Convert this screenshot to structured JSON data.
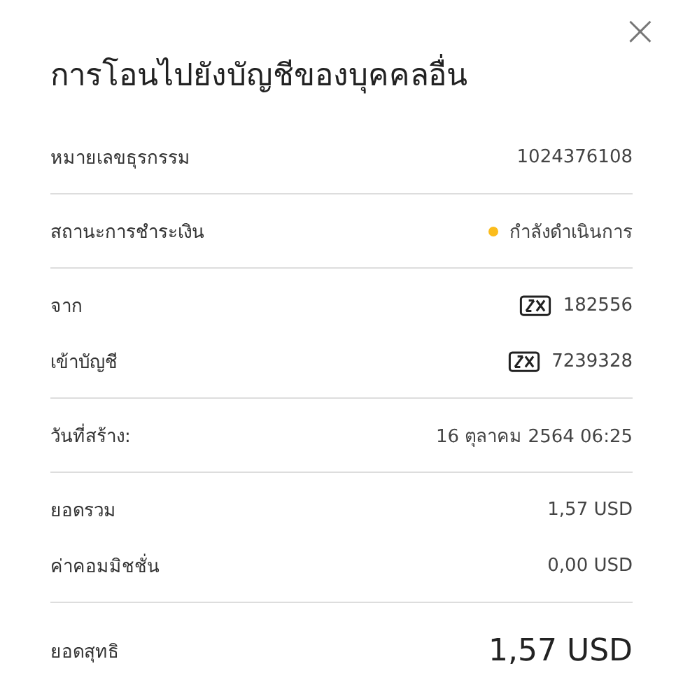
{
  "close": "×",
  "title": "การโอนไปยังบัญชีของบุคคลอื่น",
  "sections": [
    {
      "rows": [
        {
          "kind": "text",
          "label": "หมายเลขธุรกรรม",
          "value": "1024376108"
        }
      ]
    },
    {
      "rows": [
        {
          "kind": "status",
          "label": "สถานะการชำระเงิน",
          "value": "กำลังดำเนินการ",
          "color": "#fbbc1c"
        }
      ]
    },
    {
      "rows": [
        {
          "kind": "account",
          "label": "จาก",
          "value": "182556"
        },
        {
          "kind": "account",
          "label": "เข้าบัญชี",
          "value": "7239328"
        }
      ]
    },
    {
      "rows": [
        {
          "kind": "text",
          "label": "วันที่สร้าง:",
          "value": "16 ตุลาคม 2564 06:25"
        }
      ]
    },
    {
      "rows": [
        {
          "kind": "text",
          "label": "ยอดรวม",
          "value": "1,57 USD"
        },
        {
          "kind": "text",
          "label": "ค่าคอมมิชชั่น",
          "value": "0,00 USD"
        }
      ]
    },
    {
      "rows": [
        {
          "kind": "total",
          "label": "ยอดสุทธิ",
          "value": "1,57 USD"
        }
      ]
    }
  ]
}
